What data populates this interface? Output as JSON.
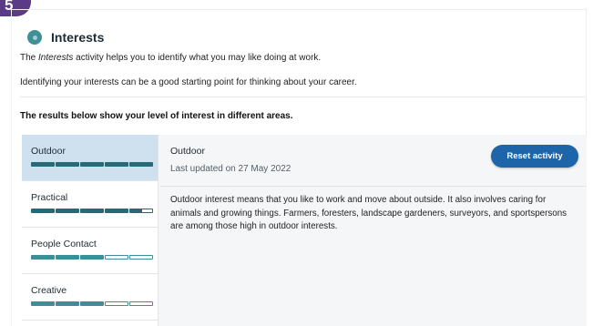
{
  "badge": {
    "text": "5"
  },
  "header": {
    "icon": "interests-icon",
    "title": "Interests"
  },
  "intro": {
    "line1_prefix": "The ",
    "line1_italic": "Interests",
    "line1_suffix": " activity helps you to identify what you may like doing at work.",
    "line2": "Identifying your interests can be a good starting point for thinking about your career."
  },
  "results_heading": "The results below show your level of interest in different areas.",
  "sidebar": {
    "items": [
      {
        "label": "Outdoor",
        "score": 5,
        "max": 5
      },
      {
        "label": "Practical",
        "score": 4.5,
        "max": 5
      },
      {
        "label": "People Contact",
        "score": 3,
        "max": 5
      },
      {
        "label": "Creative",
        "score": 3,
        "max": 5
      }
    ]
  },
  "detail": {
    "title": "Outdoor",
    "updated": "Last updated on 27 May 2022",
    "reset_label": "Reset activity",
    "description": "Outdoor interest means that you like to work and move about outside. It also involves caring for animals and growing things. Farmers, foresters, landscape gardeners, surveyors, and sportspersons are among those high in outdoor interests."
  },
  "colors": {
    "accent": "#1e64a8",
    "bar_fill": "#266977",
    "active_bg": "#cfe0ee",
    "badge": "#5b3a86"
  }
}
